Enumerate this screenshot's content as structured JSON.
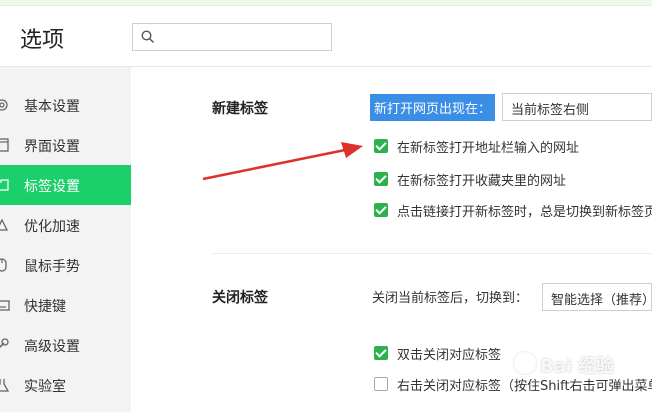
{
  "window": {
    "title": "选项"
  },
  "search": {
    "placeholder": ""
  },
  "sidebar": {
    "items": [
      {
        "label": "基本设置"
      },
      {
        "label": "界面设置"
      },
      {
        "label": "标签设置",
        "active": true
      },
      {
        "label": "优化加速"
      },
      {
        "label": "鼠标手势"
      },
      {
        "label": "快捷键"
      },
      {
        "label": "高级设置"
      },
      {
        "label": "实验室"
      }
    ]
  },
  "new_tab": {
    "title": "新建标签",
    "open_position_label": "新打开网页出现在：",
    "open_position_value": "当前标签右侧",
    "options": [
      {
        "label": "在新标签打开地址栏输入的网址",
        "checked": true
      },
      {
        "label": "在新标签打开收藏夹里的网址",
        "checked": true
      },
      {
        "label": "点击链接打开新标签时，总是切换到新标签页",
        "checked": true
      }
    ]
  },
  "close_tab": {
    "title": "关闭标签",
    "switch_label": "关闭当前标签后，切换到：",
    "switch_value": "智能选择（推荐）",
    "options": [
      {
        "label": "双击关闭对应标签",
        "checked": true
      },
      {
        "label": "右击关闭对应标签（按住Shift右击可弹出菜单）",
        "checked": false
      }
    ]
  },
  "watermark": {
    "text": "Bai 经验"
  },
  "colors": {
    "accent": "#1bd06a",
    "checkbox": "#2bb24c",
    "highlight": "#3a8ee6",
    "arrow": "#e0302a"
  }
}
